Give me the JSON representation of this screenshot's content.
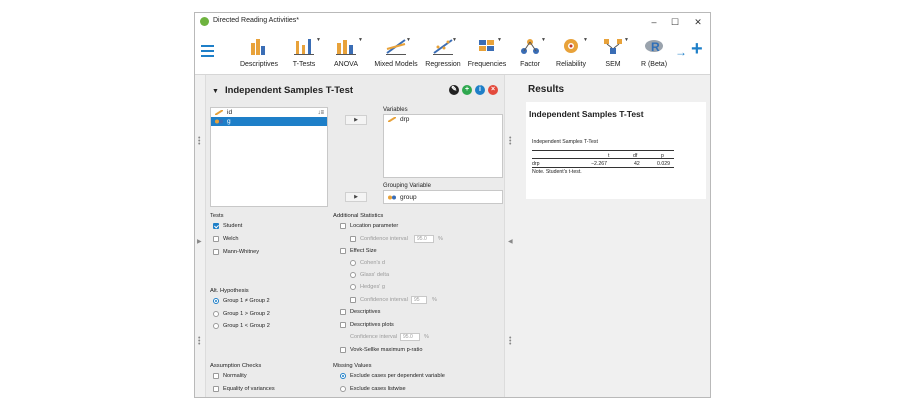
{
  "window": {
    "title": "Directed Reading Activities*",
    "controls": [
      "–",
      "☐",
      "✕"
    ]
  },
  "ribbon": {
    "items": [
      {
        "label": "Descriptives",
        "icon": "descriptives-icon"
      },
      {
        "label": "T-Tests",
        "icon": "ttests-icon"
      },
      {
        "label": "ANOVA",
        "icon": "anova-icon"
      },
      {
        "label": "Mixed Models",
        "icon": "mixed-models-icon"
      },
      {
        "label": "Regression",
        "icon": "regression-icon"
      },
      {
        "label": "Frequencies",
        "icon": "frequencies-icon"
      },
      {
        "label": "Factor",
        "icon": "factor-icon"
      },
      {
        "label": "Reliability",
        "icon": "reliability-icon"
      },
      {
        "label": "SEM",
        "icon": "sem-icon"
      },
      {
        "label": "R (Beta)",
        "icon": "r-icon"
      }
    ],
    "nav_arrow": "→",
    "plus": "+"
  },
  "analysis": {
    "title": "Independent Samples T-Test",
    "source_vars": [
      {
        "name": "id",
        "selected": false
      },
      {
        "name": "g",
        "selected": true
      }
    ],
    "variables_label": "Variables",
    "variables": [
      "drp"
    ],
    "grouping_label": "Grouping Variable",
    "grouping": "group",
    "tests_label": "Tests",
    "tests": [
      {
        "label": "Student",
        "checked": true
      },
      {
        "label": "Welch",
        "checked": false
      },
      {
        "label": "Mann-Whitney",
        "checked": false
      }
    ],
    "alt_label": "Alt. Hypothesis",
    "alt": [
      {
        "label": "Group 1 ≠ Group 2",
        "checked": true
      },
      {
        "label": "Group 1 > Group 2",
        "checked": false
      },
      {
        "label": "Group 1 < Group 2",
        "checked": false
      }
    ],
    "assump_label": "Assumption Checks",
    "assump": [
      {
        "label": "Normality",
        "checked": false
      },
      {
        "label": "Equality of variances",
        "checked": false
      }
    ],
    "addl_label": "Additional Statistics",
    "location": "Location parameter",
    "ci_label": "Confidence interval",
    "ci_value": "95.0",
    "effect": "Effect Size",
    "cohen": "Cohen's d",
    "glass": "Glass' delta",
    "hedges": "Hedges' g",
    "ci_value2": "95",
    "descriptives": "Descriptives",
    "desc_plots": "Descriptives plots",
    "ci_value3": "95.0",
    "vovk": "Vovk-Sellke maximum p-ratio",
    "missing_label": "Missing Values",
    "missing": [
      {
        "label": "Exclude cases per dependent variable",
        "checked": true
      },
      {
        "label": "Exclude cases listwise",
        "checked": false
      }
    ],
    "pct": "%"
  },
  "results": {
    "heading": "Results",
    "card_title": "Independent Samples T-Test",
    "table_title": "Independent Samples T-Test",
    "columns": [
      "",
      "t",
      "df",
      "p"
    ],
    "rows": [
      [
        "drp",
        "−2.267",
        "42",
        "0.029"
      ]
    ],
    "note": "Note. Student's t-test."
  },
  "colors": {
    "accent": "#1e7fc8",
    "green": "#2fa84f",
    "red": "#e34a3c"
  }
}
